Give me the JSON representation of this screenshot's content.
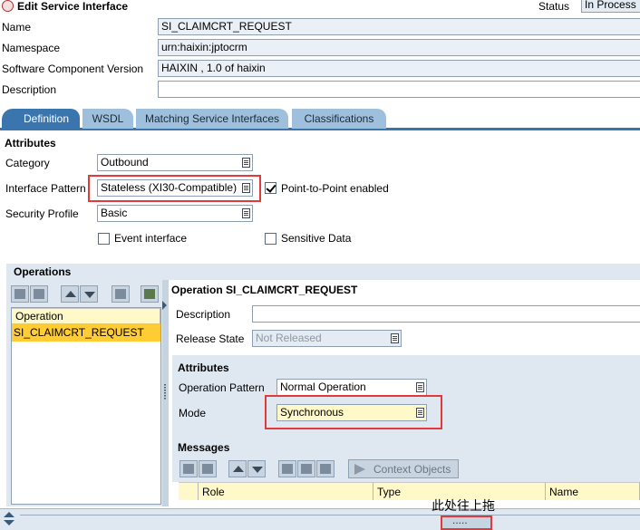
{
  "header": {
    "title": "Edit Service Interface",
    "status_label": "Status",
    "status_value": "In Process"
  },
  "form": {
    "name_label": "Name",
    "name_value": "SI_CLAIMCRT_REQUEST",
    "namespace_label": "Namespace",
    "namespace_value": "urn:haixin:jptocrm",
    "swcv_label": "Software Component Version",
    "swcv_value": "HAIXIN , 1.0 of haixin",
    "description_label": "Description",
    "description_value": ""
  },
  "tabs": [
    {
      "label": "Definition"
    },
    {
      "label": "WSDL"
    },
    {
      "label": "Matching Service Interfaces"
    },
    {
      "label": "Classifications"
    }
  ],
  "attributes": {
    "title": "Attributes",
    "category_label": "Category",
    "category_value": "Outbound",
    "pattern_label": "Interface Pattern",
    "pattern_value": "Stateless (XI30-Compatible)",
    "p2p_label": "Point-to-Point enabled",
    "security_label": "Security Profile",
    "security_value": "Basic",
    "event_label": "Event interface",
    "sensitive_label": "Sensitive Data"
  },
  "operations": {
    "title": "Operations",
    "list_header": "Operation",
    "items": [
      "SI_CLAIMCRT_REQUEST"
    ],
    "detail_title": "Operation SI_CLAIMCRT_REQUEST",
    "description_label": "Description",
    "release_label": "Release State",
    "release_value": "Not Released",
    "attr_title": "Attributes",
    "op_pattern_label": "Operation Pattern",
    "op_pattern_value": "Normal Operation",
    "mode_label": "Mode",
    "mode_value": "Synchronous",
    "messages_title": "Messages",
    "context_objects_label": "Context Objects",
    "columns": [
      "Role",
      "Type",
      "Name"
    ]
  },
  "annotation": {
    "text": "此处往上拖",
    "handle": "....."
  },
  "colors": {
    "tab_active": "#3a76ad",
    "tab_inactive": "#9fc0dc",
    "highlight": "#e23a3a",
    "selection": "#ffcc33"
  }
}
